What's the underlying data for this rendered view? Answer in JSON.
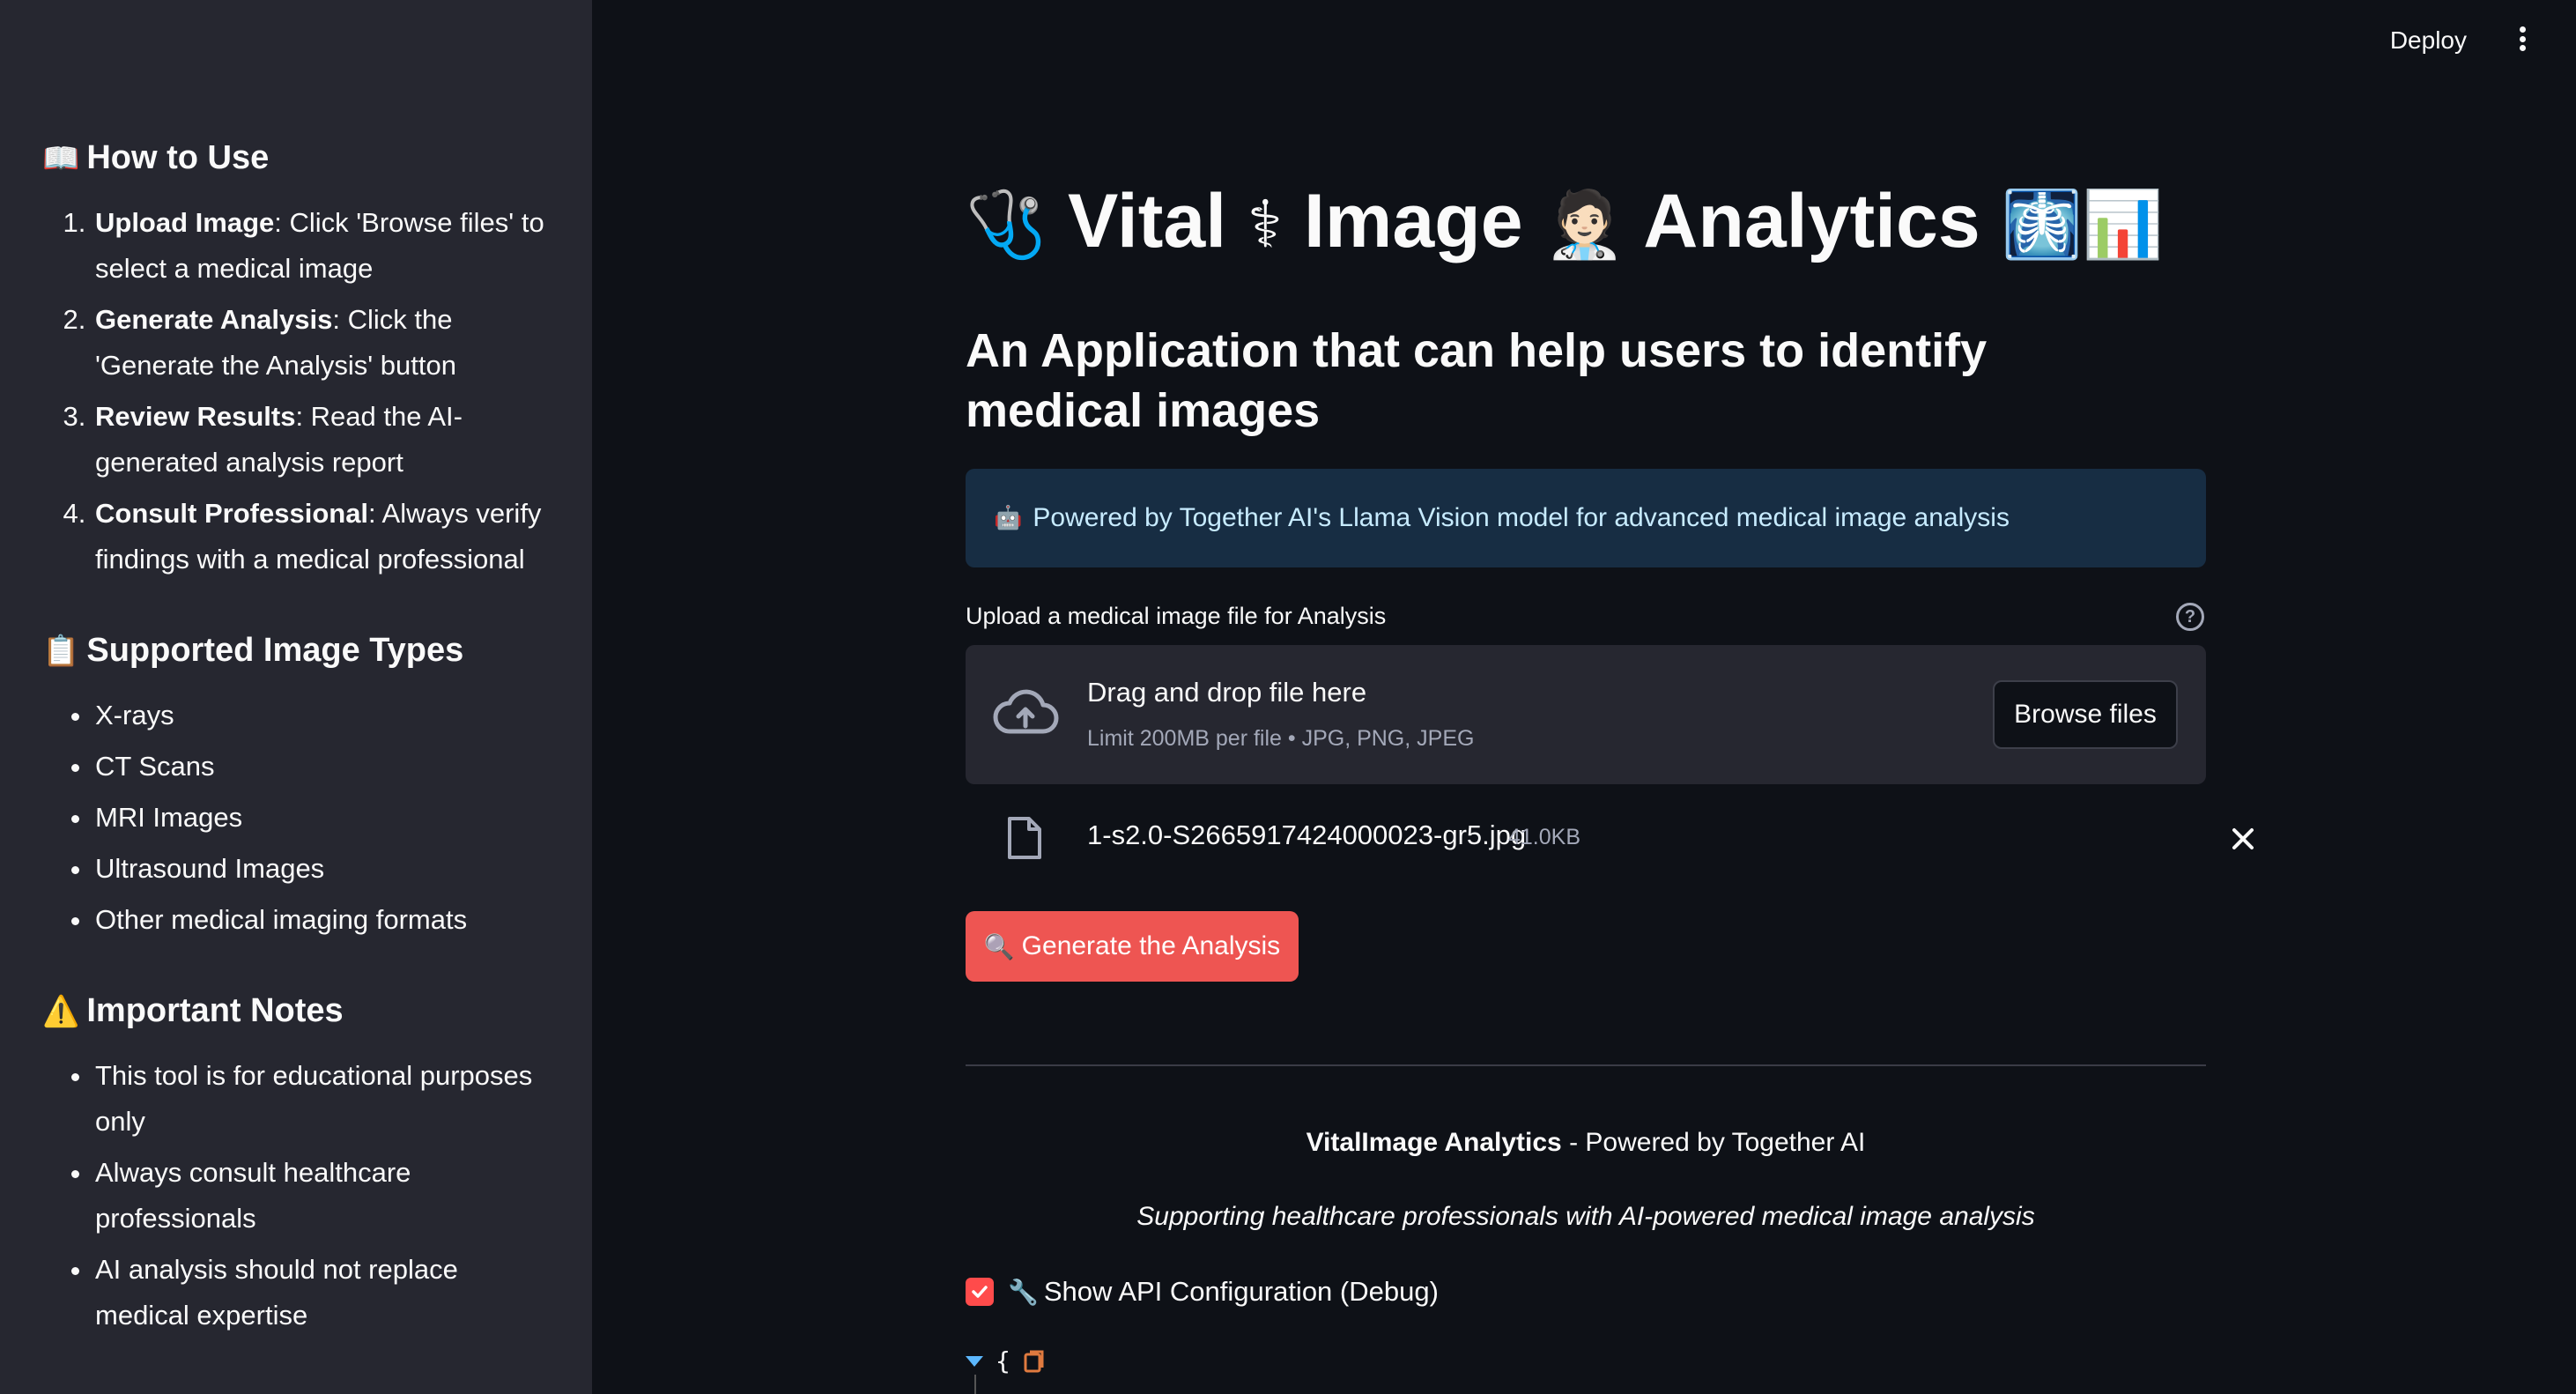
{
  "topbar": {
    "deploy_label": "Deploy",
    "menu_icon": "more-vertical-icon"
  },
  "sidebar": {
    "how_to_use": {
      "icon": "📖",
      "title": "How to Use",
      "steps": [
        {
          "bold": "Upload Image",
          "text": ": Click 'Browse files' to select a medical image"
        },
        {
          "bold": "Generate Analysis",
          "text": ": Click the 'Generate the Analysis' button"
        },
        {
          "bold": "Review Results",
          "text": ": Read the AI-generated analysis report"
        },
        {
          "bold": "Consult Professional",
          "text": ": Always verify findings with a medical professional"
        }
      ]
    },
    "supported_types": {
      "icon": "📋",
      "title": "Supported Image Types",
      "items": [
        "X-rays",
        "CT Scans",
        "MRI Images",
        "Ultrasound Images",
        "Other medical imaging formats"
      ]
    },
    "important_notes": {
      "icon": "⚠️",
      "title": "Important Notes",
      "items": [
        "This tool is for educational purposes only",
        "Always consult healthcare professionals",
        "AI analysis should not replace medical expertise"
      ]
    }
  },
  "main": {
    "title": {
      "e1": "🩺",
      "w1": "Vital",
      "e2": "⚕",
      "w2": "Image",
      "e3": "🧑🏻‍⚕️",
      "w3": "Analytics",
      "e4": "🩻📊"
    },
    "subtitle": "An Application that can help users to identify medical images",
    "info": {
      "icon": "🤖",
      "text": "Powered by Together AI's Llama Vision model for advanced medical image analysis"
    },
    "uploader": {
      "label": "Upload a medical image file for Analysis",
      "help": "?",
      "drop_title": "Drag and drop file here",
      "drop_limit": "Limit 200MB per file • JPG, PNG, JPEG",
      "browse_label": "Browse files"
    },
    "file": {
      "name": "1-s2.0-S2665917424000023-gr5.jpg",
      "size": "41.0KB"
    },
    "generate": {
      "icon": "🔍",
      "label": "Generate the Analysis"
    },
    "footer": {
      "brand": "VitalImage Analytics",
      "powered": " - Powered by Together AI",
      "tagline": "Supporting healthcare professionals with AI-powered medical image analysis"
    },
    "debug": {
      "checked": true,
      "icon": "🔧",
      "label": "Show API Configuration (Debug)",
      "json_open": "{"
    }
  },
  "colors": {
    "background": "#0e1117",
    "sidebar": "#262730",
    "primary": "#ff4b4b",
    "info_bg": "#172d43",
    "info_text": "#c7ebff"
  }
}
